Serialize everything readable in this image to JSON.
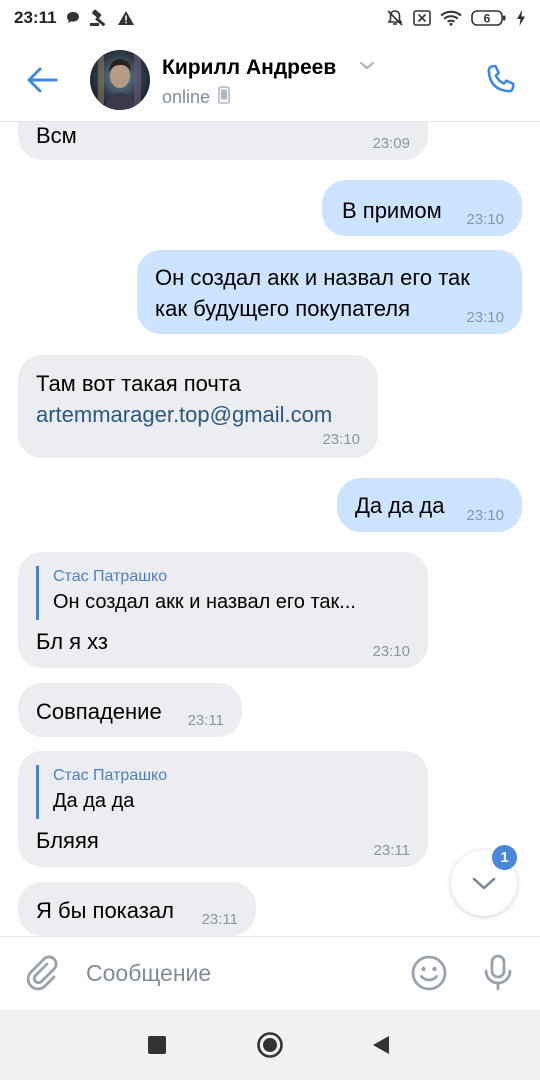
{
  "status_bar": {
    "time": "23:11",
    "battery": "6"
  },
  "header": {
    "contact_name": "Кирилл Андреев",
    "contact_status": "online"
  },
  "messages": [
    {
      "direction": "in",
      "text": "Всм",
      "time": "23:09"
    },
    {
      "direction": "out",
      "text": "В примом",
      "time": "23:10"
    },
    {
      "direction": "out",
      "lines": [
        "Он создал акк и назвал его так",
        "как будущего покупателя"
      ],
      "time": "23:10"
    },
    {
      "direction": "in",
      "text": "Там вот такая почта",
      "link": "artemmarager.top@gmail.com",
      "time": "23:10"
    },
    {
      "direction": "out",
      "text": "Да да да",
      "time": "23:10"
    },
    {
      "direction": "in",
      "reply_author": "Стас Патрашко",
      "reply_text": "Он создал акк и назвал его так...",
      "text": "Бл я хз",
      "time": "23:10"
    },
    {
      "direction": "in",
      "text": "Совпадение",
      "time": "23:11"
    },
    {
      "direction": "in",
      "reply_author": "Стас Патрашко",
      "reply_text": "Да да да",
      "text": "Бляяя",
      "time": "23:11"
    },
    {
      "direction": "in",
      "text": "Я бы показал",
      "time": "23:11"
    }
  ],
  "scroll_down": {
    "unread_count": "1"
  },
  "composer": {
    "placeholder": "Сообщение"
  },
  "colors": {
    "accent": "#5181b8",
    "incoming_bubble": "#ebedf0",
    "outgoing_bubble": "#cce4ff",
    "link": "#2a5885"
  }
}
